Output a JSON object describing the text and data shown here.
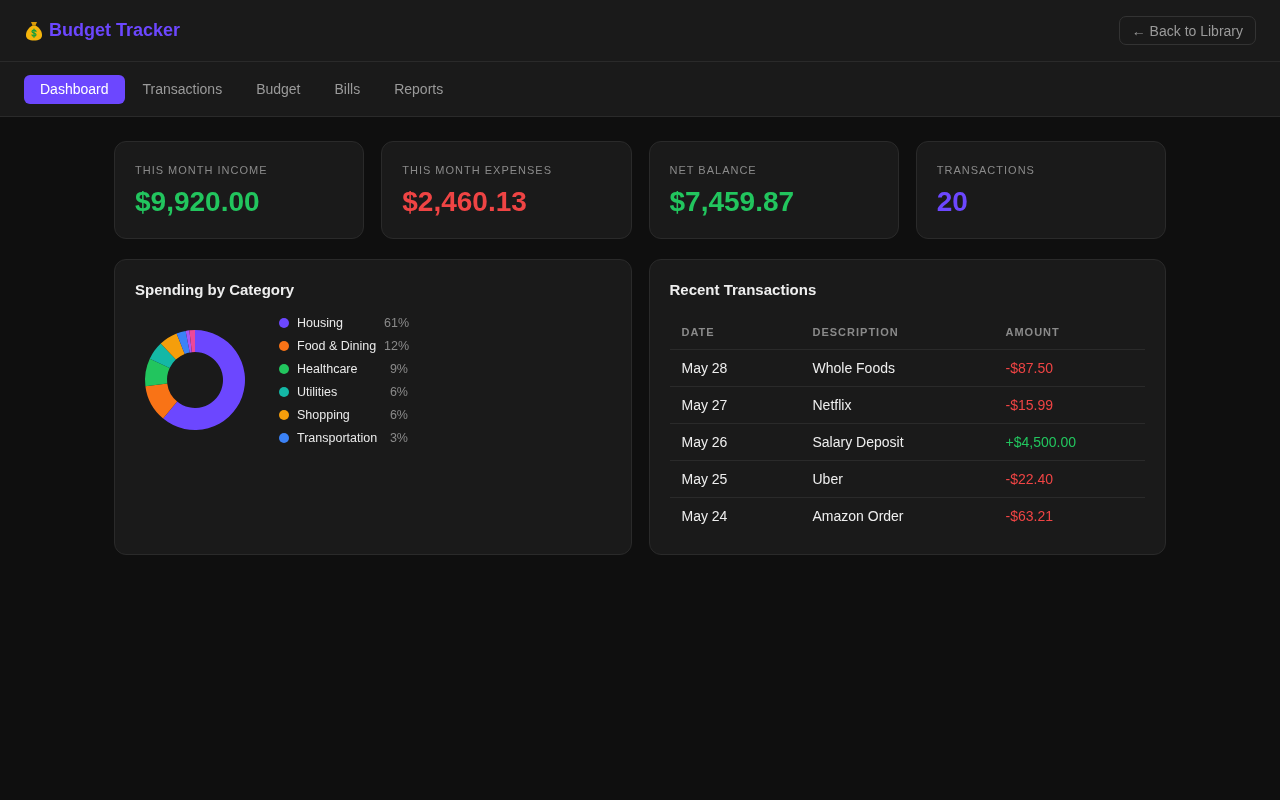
{
  "header": {
    "title": "Budget Tracker",
    "back_button": "← Back to Library"
  },
  "tabs": [
    {
      "label": "Dashboard",
      "selected": true
    },
    {
      "label": "Transactions",
      "selected": false
    },
    {
      "label": "Budget",
      "selected": false
    },
    {
      "label": "Bills",
      "selected": false
    },
    {
      "label": "Reports",
      "selected": false
    }
  ],
  "stats": [
    {
      "label": "THIS MONTH INCOME",
      "value": "$9,920.00",
      "color": "#22c55e"
    },
    {
      "label": "THIS MONTH EXPENSES",
      "value": "$2,460.13",
      "color": "#ef4444"
    },
    {
      "label": "NET BALANCE",
      "value": "$7,459.87",
      "color": "#22c55e"
    },
    {
      "label": "TRANSACTIONS",
      "value": "20",
      "color": "#6c47ff"
    }
  ],
  "spending": {
    "title": "Spending by Category",
    "chart_data": {
      "type": "donut",
      "values": [
        61,
        12,
        9,
        6,
        6,
        3,
        1.2,
        1.8
      ],
      "colors": [
        "#6c47ff",
        "#f97316",
        "#22c55e",
        "#14b8a6",
        "#f59e0b",
        "#3b82f6",
        "#a855f7",
        "#ec4899"
      ]
    },
    "legend": [
      {
        "label": "Housing",
        "percent": "61%",
        "color": "#6c47ff"
      },
      {
        "label": "Food & Dining",
        "percent": "12%",
        "color": "#f97316"
      },
      {
        "label": "Healthcare",
        "percent": "9%",
        "color": "#22c55e"
      },
      {
        "label": "Utilities",
        "percent": "6%",
        "color": "#14b8a6"
      },
      {
        "label": "Shopping",
        "percent": "6%",
        "color": "#f59e0b"
      },
      {
        "label": "Transportation",
        "percent": "3%",
        "color": "#3b82f6"
      }
    ]
  },
  "recent": {
    "title": "Recent Transactions",
    "columns": [
      "DATE",
      "DESCRIPTION",
      "AMOUNT"
    ],
    "rows": [
      {
        "date": "May 28",
        "description": "Whole Foods",
        "amount": "-$87.50",
        "color": "#ef4444"
      },
      {
        "date": "May 27",
        "description": "Netflix",
        "amount": "-$15.99",
        "color": "#ef4444"
      },
      {
        "date": "May 26",
        "description": "Salary Deposit",
        "amount": "+$4,500.00",
        "color": "#22c55e"
      },
      {
        "date": "May 25",
        "description": "Uber",
        "amount": "-$22.40",
        "color": "#ef4444"
      },
      {
        "date": "May 24",
        "description": "Amazon Order",
        "amount": "-$63.21",
        "color": "#ef4444"
      }
    ]
  }
}
